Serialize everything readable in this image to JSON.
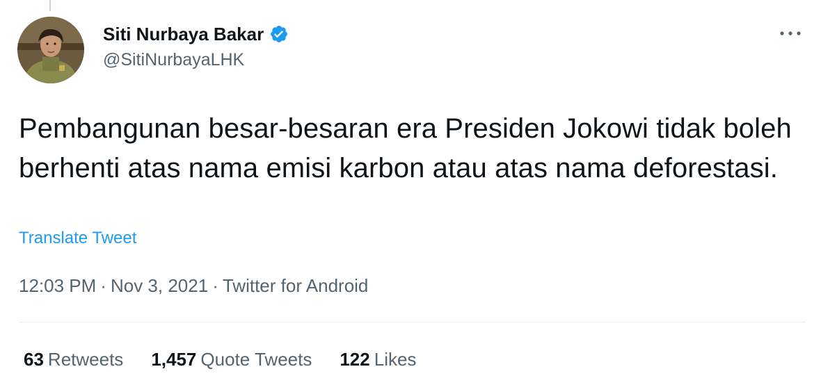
{
  "tweet": {
    "author": {
      "display_name": "Siti Nurbaya Bakar",
      "handle": "@SitiNurbayaLHK",
      "verified": true,
      "avatar_icon": "profile-photo"
    },
    "text": "Pembangunan besar-besaran era Presiden Jokowi tidak boleh berhenti atas nama emisi karbon atau atas nama deforestasi.",
    "translate_label": "Translate Tweet",
    "meta": {
      "time": "12:03 PM",
      "date": "Nov 3, 2021",
      "source": "Twitter for Android",
      "separator": "·"
    },
    "stats": {
      "retweets_count": "63",
      "retweets_label": "Retweets",
      "quote_count": "1,457",
      "quote_label": "Quote Tweets",
      "likes_count": "122",
      "likes_label": "Likes"
    },
    "more_icon": "more-icon"
  },
  "colors": {
    "accent": "#1d9bf0",
    "text_primary": "#0f1419",
    "text_secondary": "#536471",
    "divider": "#e7ebed"
  }
}
